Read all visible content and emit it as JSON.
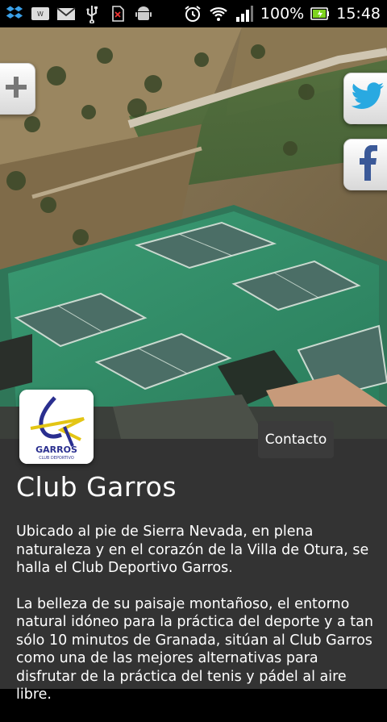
{
  "status_bar": {
    "battery_percent": "100%",
    "time": "15:48",
    "icons": [
      "dropbox-icon",
      "wifi-dev-icon",
      "gmail-icon",
      "usb-icon",
      "no-sim-icon",
      "android-icon",
      "alarm-icon",
      "wifi-icon",
      "signal-icon",
      "battery-icon"
    ]
  },
  "social": {
    "add_icon": "plus-icon",
    "twitter_icon": "twitter-bird-icon",
    "facebook_icon": "facebook-f-icon"
  },
  "hero": {
    "image": "aerial view of tennis and padel courts"
  },
  "logo": {
    "text": "GARROS",
    "subtext": "CLUB DEPORTIVO"
  },
  "contact": {
    "label": "Contacto"
  },
  "club": {
    "title": "Club Garros",
    "paragraphs": [
      "Ubicado al pie de Sierra Nevada, en plena naturaleza y en el corazón de la Villa de Otura, se halla el Club Deportivo Garros.",
      "La belleza de su paisaje montañoso, el entorno natural idóneo para la práctica del deporte y a tan sólo 10 minutos de Granada, sitúan al Club Garros como una de las mejores alternativas para disfrutar de la práctica del tenis y pádel al aire libre."
    ]
  },
  "colors": {
    "accent_blue": "#29a9e1",
    "facebook_blue": "#3b5998",
    "court_green": "#2e8f6a"
  }
}
